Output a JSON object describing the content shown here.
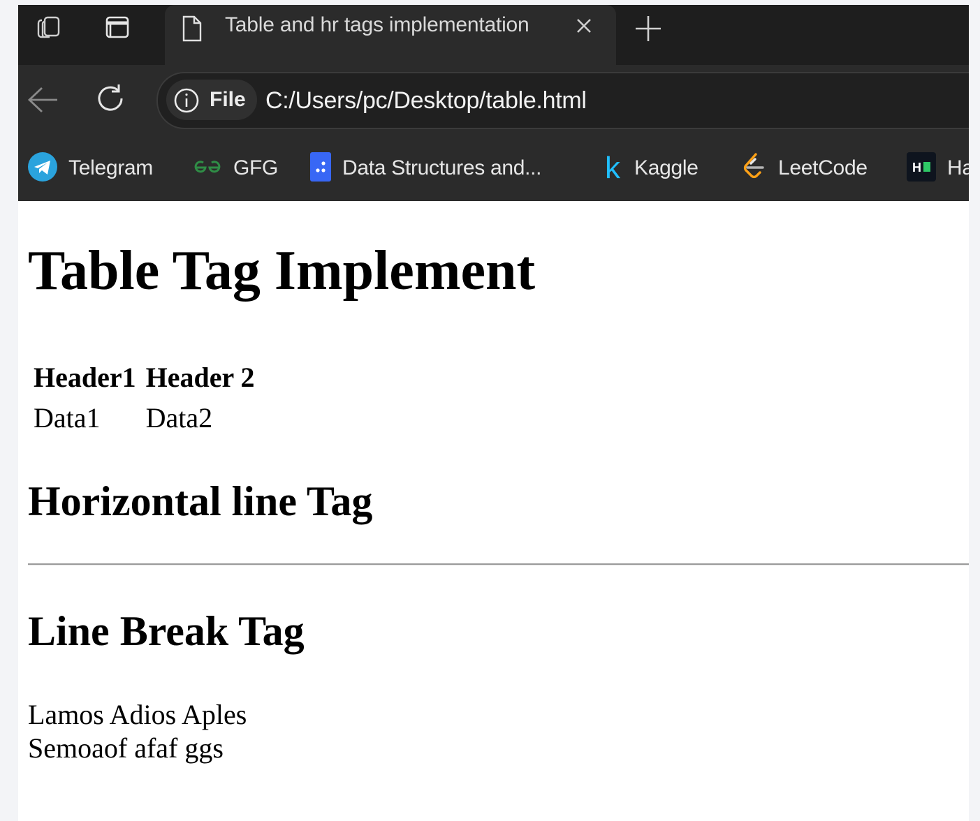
{
  "browser": {
    "tab": {
      "title": "Table and hr tags implementation"
    },
    "address": {
      "scheme_label": "File",
      "url": "C:/Users/pc/Desktop/table.html"
    },
    "bookmarks": [
      {
        "label": "Telegram",
        "icon": "telegram-icon"
      },
      {
        "label": "GFG",
        "icon": "gfg-icon"
      },
      {
        "label": "Data Structures and...",
        "icon": "dsa-icon"
      },
      {
        "label": "Kaggle",
        "icon": "kaggle-icon"
      },
      {
        "label": "LeetCode",
        "icon": "leetcode-icon"
      },
      {
        "label": "Ha",
        "icon": "hackerrank-icon"
      }
    ],
    "colors": {
      "chrome_dark": "#1e1e1e",
      "chrome": "#2b2b2b",
      "telegram": "#2aa3dd",
      "gfg": "#2f8d46",
      "kaggle": "#20beff",
      "leetcode": "#ffa116",
      "dsa": "#3867f5"
    }
  },
  "page": {
    "heading1": "Table Tag Implement",
    "table": {
      "headers": [
        "Header1",
        "Header 2"
      ],
      "rows": [
        [
          "Data1",
          "Data2"
        ]
      ]
    },
    "heading_hr": "Horizontal line Tag",
    "heading_br": "Line Break Tag",
    "br_lines": [
      "Lamos Adios Aples",
      "Semoaof afaf ggs"
    ]
  }
}
